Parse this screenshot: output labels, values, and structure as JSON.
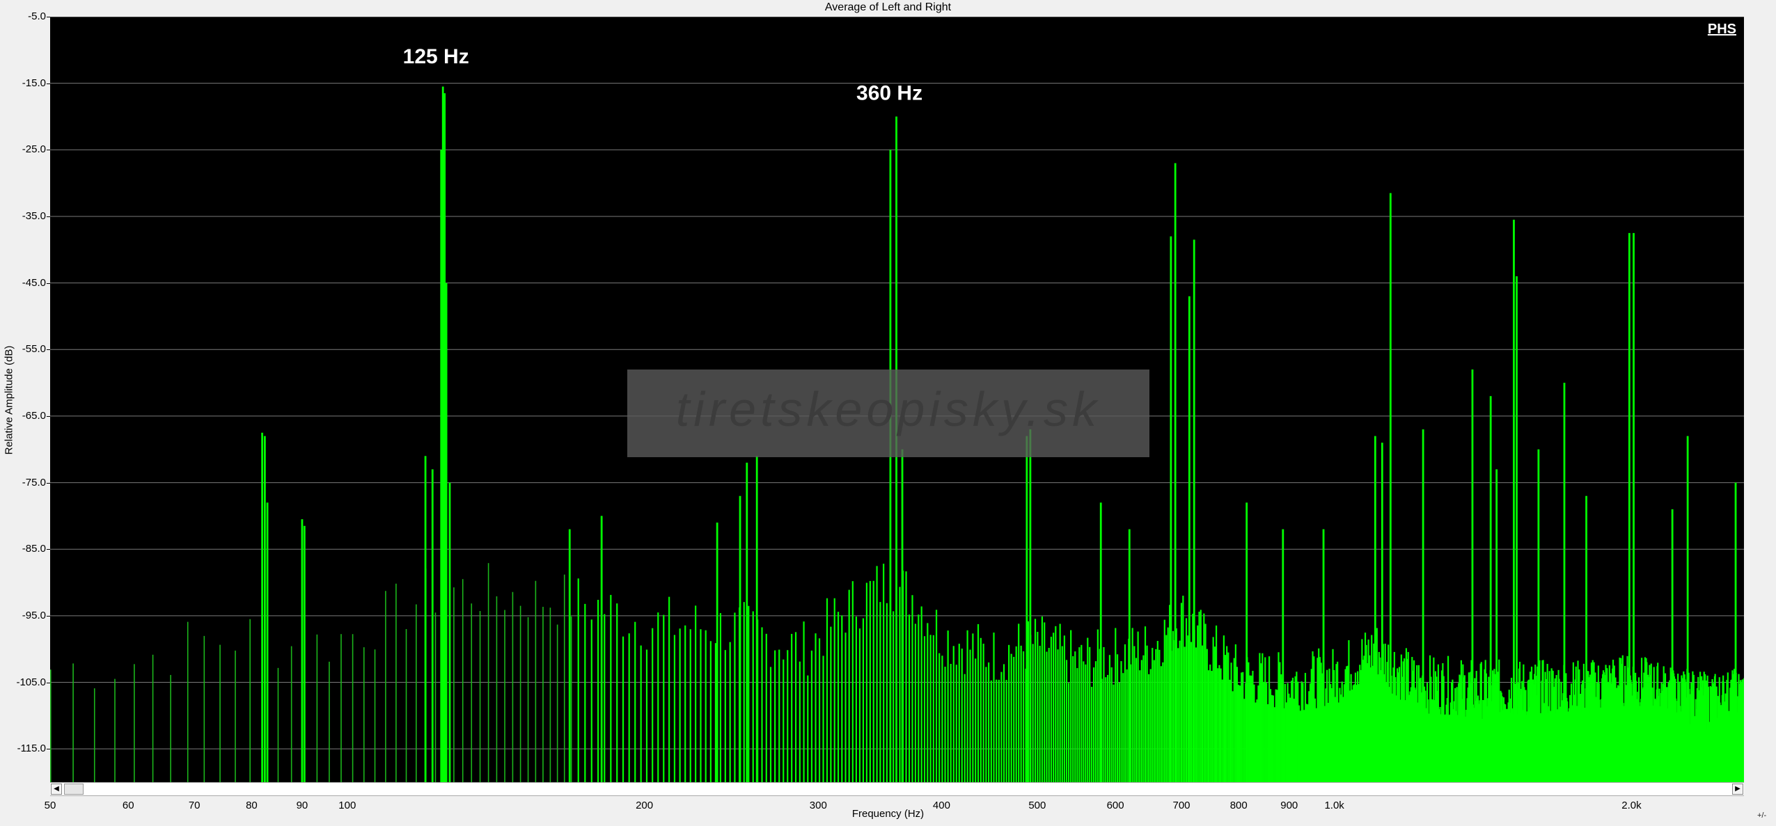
{
  "window": {
    "title": "Average of Left and Right"
  },
  "watermark": {
    "text": "tiretskeopisky.sk"
  },
  "brand_badge": "PHS",
  "colors": {
    "background": "#000000",
    "spectrum": "#00ff00",
    "grid": "#7a7a7a",
    "watermark_box": "#5a5a5a"
  },
  "controls": {
    "zoom_label": "+/-",
    "scroll_left_icon": "chevron-left-icon",
    "scroll_right_icon": "chevron-right-icon"
  },
  "chart_data": {
    "type": "area",
    "title": "Average of Left and Right",
    "xlabel": "Frequency (Hz)",
    "ylabel": "Relative Amplitude (dB)",
    "xscale": "log",
    "xlim": [
      50,
      2600
    ],
    "ylim": [
      -120,
      -5
    ],
    "grid": true,
    "yticks": [
      -5,
      -15,
      -25,
      -35,
      -45,
      -55,
      -65,
      -75,
      -85,
      -95,
      -105,
      -115
    ],
    "ytick_labels": [
      "-5.0",
      "-15.0",
      "-25.0",
      "-35.0",
      "-45.0",
      "-55.0",
      "-65.0",
      "-75.0",
      "-85.0",
      "-95.0",
      "-105.0",
      "-115.0"
    ],
    "xticks": [
      50,
      60,
      70,
      80,
      90,
      100,
      200,
      300,
      400,
      500,
      600,
      700,
      800,
      900,
      1000,
      2000
    ],
    "xtick_labels": [
      "50",
      "60",
      "70",
      "80",
      "90",
      "100",
      "200",
      "300",
      "400",
      "500",
      "600",
      "700",
      "800",
      "900",
      "1.0k",
      "2.0k"
    ],
    "noise_floor": [
      [
        50,
        -103
      ],
      [
        60,
        -102
      ],
      [
        70,
        -99
      ],
      [
        80,
        -98
      ],
      [
        90,
        -100
      ],
      [
        100,
        -98
      ],
      [
        110,
        -95
      ],
      [
        120,
        -92
      ],
      [
        130,
        -91
      ],
      [
        150,
        -92
      ],
      [
        175,
        -93
      ],
      [
        200,
        -96
      ],
      [
        250,
        -97
      ],
      [
        290,
        -100
      ],
      [
        320,
        -94
      ],
      [
        350,
        -90
      ],
      [
        375,
        -92
      ],
      [
        400,
        -98
      ],
      [
        450,
        -101
      ],
      [
        500,
        -99
      ],
      [
        550,
        -102
      ],
      [
        650,
        -100
      ],
      [
        700,
        -95
      ],
      [
        750,
        -100
      ],
      [
        800,
        -104
      ],
      [
        900,
        -105
      ],
      [
        1000,
        -104
      ],
      [
        1100,
        -100
      ],
      [
        1200,
        -105
      ],
      [
        1400,
        -106
      ],
      [
        1600,
        -106
      ],
      [
        1800,
        -106
      ],
      [
        2000,
        -105
      ],
      [
        2200,
        -107
      ],
      [
        2400,
        -108
      ],
      [
        2600,
        -107
      ]
    ],
    "peaks": [
      {
        "x": 82,
        "y": -67.5
      },
      {
        "x": 82.5,
        "y": -68
      },
      {
        "x": 83,
        "y": -78
      },
      {
        "x": 90,
        "y": -80.5
      },
      {
        "x": 90.5,
        "y": -81.5
      },
      {
        "x": 120,
        "y": -71
      },
      {
        "x": 122,
        "y": -73
      },
      {
        "x": 124.5,
        "y": -25
      },
      {
        "x": 125,
        "y": -15.5
      },
      {
        "x": 125.5,
        "y": -16.5
      },
      {
        "x": 126,
        "y": -45
      },
      {
        "x": 127,
        "y": -75
      },
      {
        "x": 168,
        "y": -82
      },
      {
        "x": 181,
        "y": -80
      },
      {
        "x": 237,
        "y": -81
      },
      {
        "x": 250,
        "y": -77
      },
      {
        "x": 254,
        "y": -72
      },
      {
        "x": 260,
        "y": -71
      },
      {
        "x": 355,
        "y": -25
      },
      {
        "x": 360,
        "y": -20
      },
      {
        "x": 365,
        "y": -70
      },
      {
        "x": 488,
        "y": -68
      },
      {
        "x": 492,
        "y": -67
      },
      {
        "x": 580,
        "y": -78
      },
      {
        "x": 620,
        "y": -82
      },
      {
        "x": 683,
        "y": -38
      },
      {
        "x": 690,
        "y": -27
      },
      {
        "x": 713,
        "y": -47
      },
      {
        "x": 721,
        "y": -38.5
      },
      {
        "x": 815,
        "y": -78
      },
      {
        "x": 887,
        "y": -82
      },
      {
        "x": 975,
        "y": -82
      },
      {
        "x": 1100,
        "y": -68
      },
      {
        "x": 1118,
        "y": -69
      },
      {
        "x": 1140,
        "y": -31.5
      },
      {
        "x": 1230,
        "y": -67
      },
      {
        "x": 1380,
        "y": -58
      },
      {
        "x": 1440,
        "y": -62
      },
      {
        "x": 1460,
        "y": -73
      },
      {
        "x": 1520,
        "y": -35.5
      },
      {
        "x": 1530,
        "y": -44
      },
      {
        "x": 1610,
        "y": -70
      },
      {
        "x": 1710,
        "y": -60
      },
      {
        "x": 1800,
        "y": -77
      },
      {
        "x": 1990,
        "y": -37.5
      },
      {
        "x": 2010,
        "y": -37.5
      },
      {
        "x": 2200,
        "y": -79
      },
      {
        "x": 2280,
        "y": -68
      },
      {
        "x": 2550,
        "y": -75
      }
    ],
    "annotations": [
      {
        "x": 125,
        "y": -12,
        "text": "125 Hz"
      },
      {
        "x": 360,
        "y": -17.5,
        "text": "360 Hz"
      }
    ]
  }
}
